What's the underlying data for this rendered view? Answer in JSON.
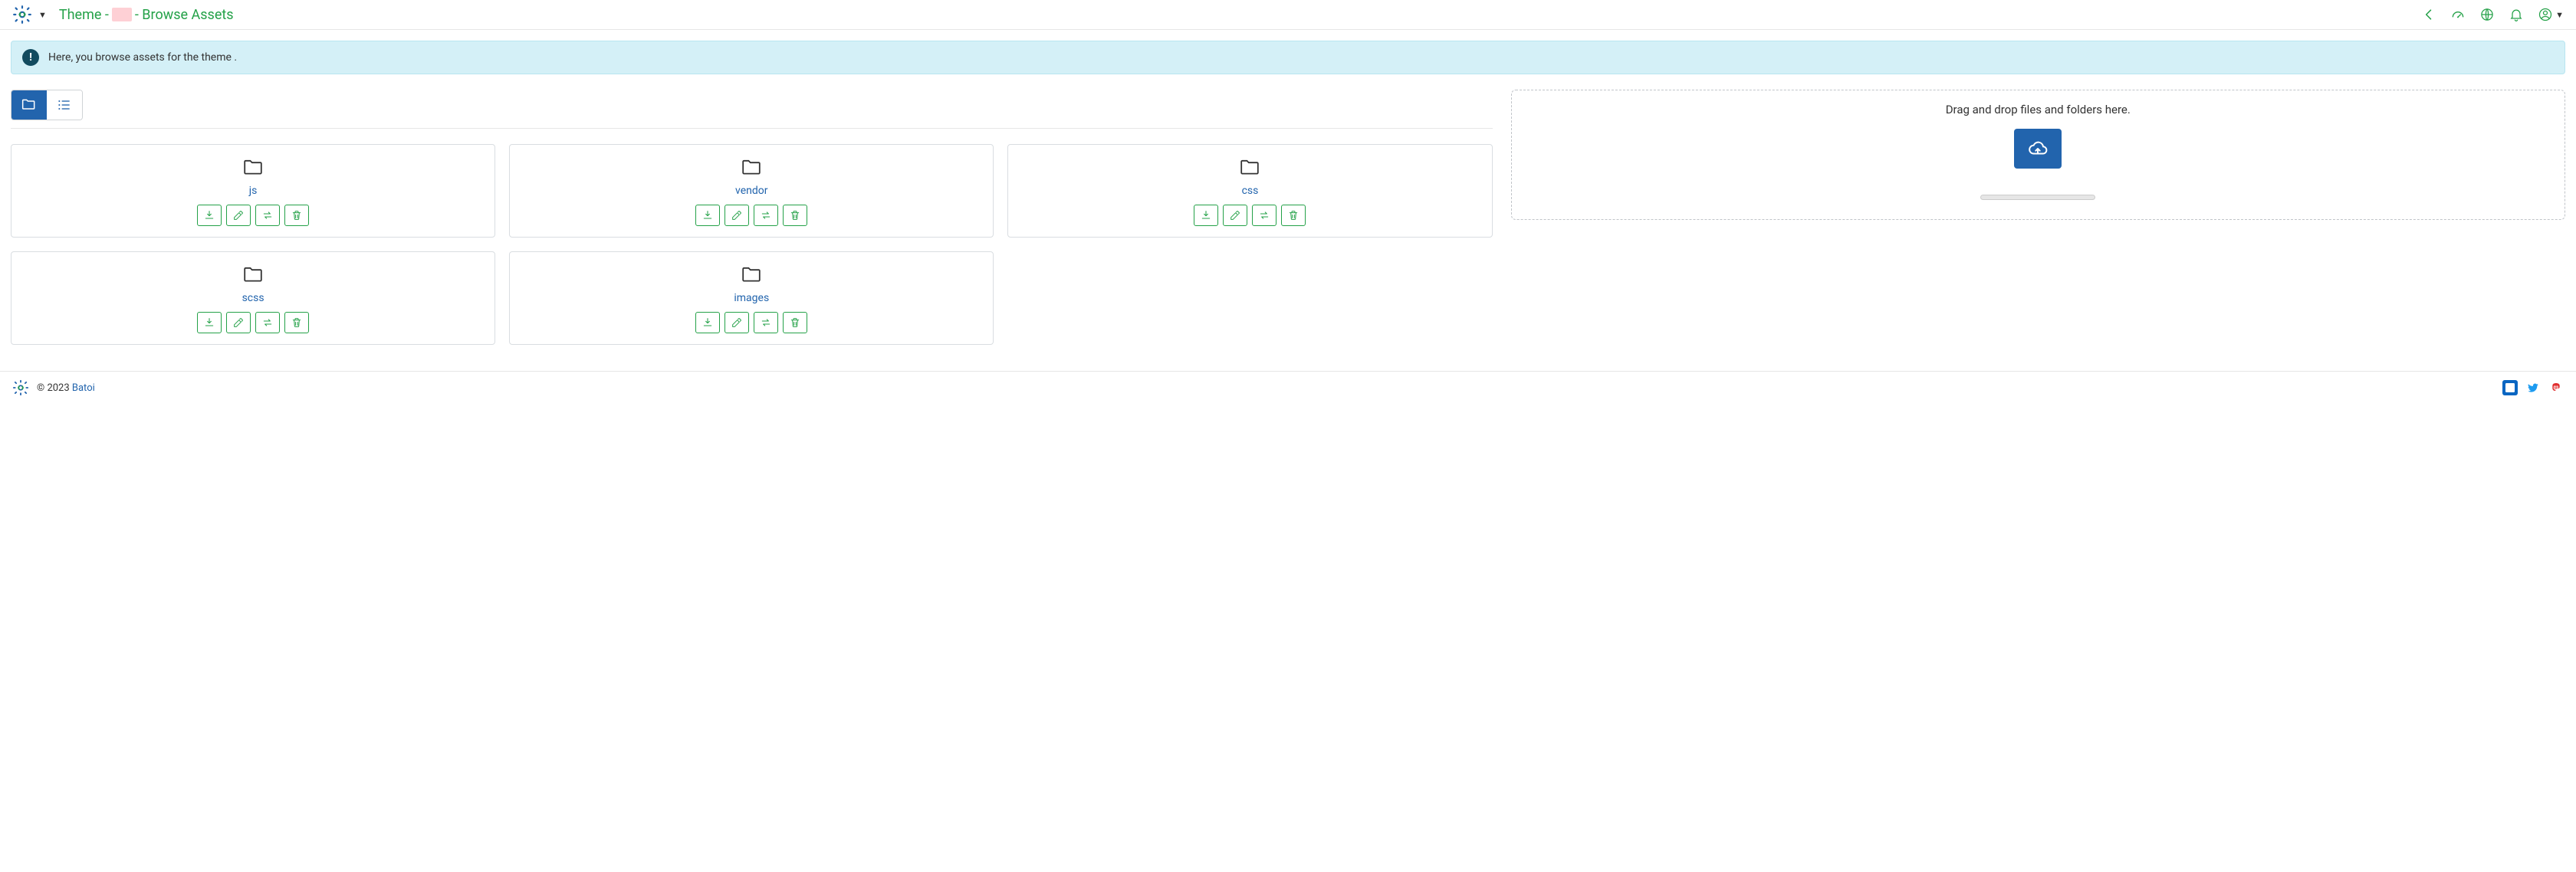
{
  "header": {
    "title_prefix": "Theme - ",
    "title_suffix": " - Browse Assets"
  },
  "banner": {
    "text": "Here, you browse assets for the theme     ."
  },
  "dropzone": {
    "text": "Drag and drop files and folders here."
  },
  "folders": [
    {
      "name": "js"
    },
    {
      "name": "vendor"
    },
    {
      "name": "css"
    },
    {
      "name": "scss"
    },
    {
      "name": "images"
    }
  ],
  "footer": {
    "copyright_prefix": "© 2023 ",
    "brand": "Batoi"
  }
}
